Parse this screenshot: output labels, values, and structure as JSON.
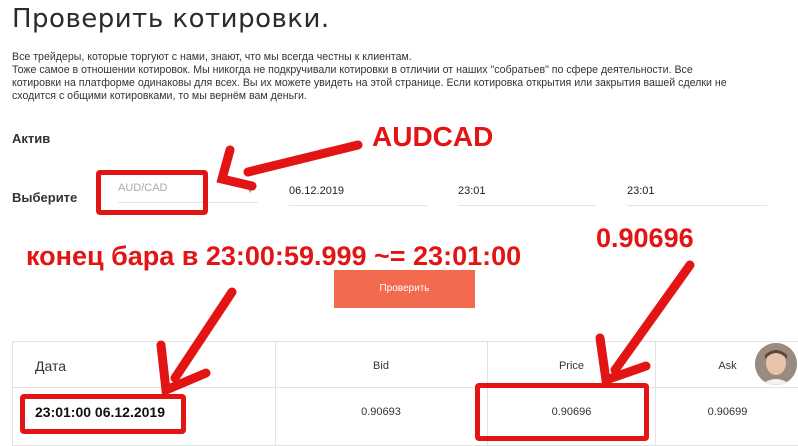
{
  "page": {
    "title": "Проверить котировки.",
    "description": [
      "Все трейдеры, которые торгуют с нами, знают, что мы всегда честны к клиентам.",
      "Тоже самое в отношении котировок. Мы никогда не подкручивали котировки в отличии от наших \"собратьев\" по сфере деятельности. Все",
      "котировки на платформе одинаковы для всех. Вы их можете увидеть на этой странице. Если котировка открытия или закрытия вашей сделки не",
      "сходится с общими котировками, то мы вернём вам деньги."
    ]
  },
  "form": {
    "asset_label": "Актив",
    "select_label": "Выберите",
    "asset_placeholder": "AUD/CAD",
    "date_value": "06.12.2019",
    "time_from": "23:01",
    "time_to": "23:01",
    "submit_label": "Проверить"
  },
  "table": {
    "headers": [
      "Дата",
      "Bid",
      "Price",
      "Ask"
    ],
    "row": {
      "date": "23:01:00 06.12.2019",
      "bid": "0.90693",
      "price": "0.90696",
      "ask": "0.90699"
    }
  },
  "annotations": {
    "asset_note": "AUDCAD",
    "bar_end_note": "конец бара в 23:00:59.999 ~= 23:01:00",
    "price_note": "0.90696",
    "color": "#e31414"
  },
  "icons": {
    "caret": "caret-down-icon",
    "avatar": "support-avatar"
  }
}
